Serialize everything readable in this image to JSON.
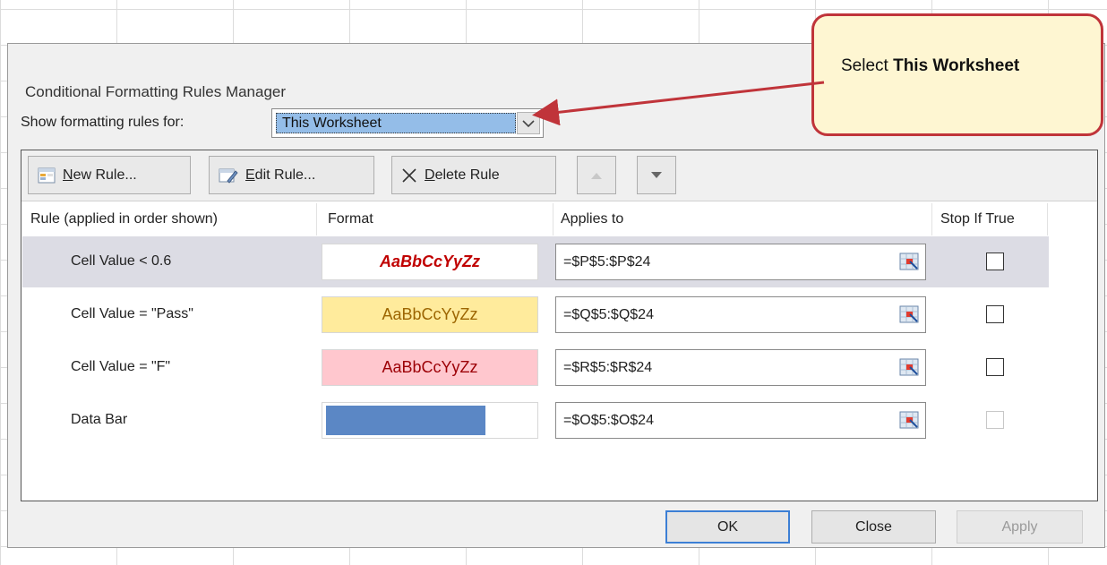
{
  "dialog": {
    "title": "Conditional Formatting Rules Manager",
    "show_rules_label": "Show formatting rules for:",
    "show_rules_value": "This Worksheet"
  },
  "toolbar": {
    "new_rule": "New Rule...",
    "edit_rule": "Edit Rule...",
    "delete_rule": "Delete Rule",
    "move_up_icon": "triangle-up-icon",
    "move_down_icon": "triangle-down-icon"
  },
  "columns": {
    "rule": "Rule (applied in order shown)",
    "format": "Format",
    "applies_to": "Applies to",
    "stop_if_true": "Stop If True"
  },
  "rules": [
    {
      "rule": "Cell Value < 0.6",
      "format_preview": "AaBbCcYyZz",
      "format_style": "bold italic red text",
      "format_text_color": "#c00000",
      "format_bg": "#ffffff",
      "applies_to": "=$P$5:$P$24",
      "stop_if_true": false
    },
    {
      "rule": "Cell Value = \"Pass\"",
      "format_preview": "AaBbCcYyZz",
      "format_style": "dark yellow text on light yellow fill",
      "format_text_color": "#9c6500",
      "format_bg": "#ffeb9c",
      "applies_to": "=$Q$5:$Q$24",
      "stop_if_true": false
    },
    {
      "rule": "Cell Value = \"F\"",
      "format_preview": "AaBbCcYyZz",
      "format_style": "dark red text on light red fill",
      "format_text_color": "#9c0006",
      "format_bg": "#ffc7ce",
      "applies_to": "=$R$5:$R$24",
      "stop_if_true": false
    },
    {
      "rule": "Data Bar",
      "format_preview": "",
      "format_style": "blue data bar",
      "format_text_color": "#5b87c5",
      "format_bg": "#ffffff",
      "applies_to": "=$O$5:$O$24",
      "stop_if_true": false,
      "stop_if_true_enabled": false
    }
  ],
  "buttons": {
    "ok": "OK",
    "close": "Close",
    "apply": "Apply"
  },
  "callout": {
    "text_prefix": "Select ",
    "text_bold": "This Worksheet",
    "border_color": "#c0343a",
    "fill_color": "#fef6d2"
  },
  "colors": {
    "selection_highlight": "#94bde8",
    "selected_row": "#dcdce4",
    "data_bar": "#5b87c5",
    "default_button_border": "#3c7fd5"
  }
}
